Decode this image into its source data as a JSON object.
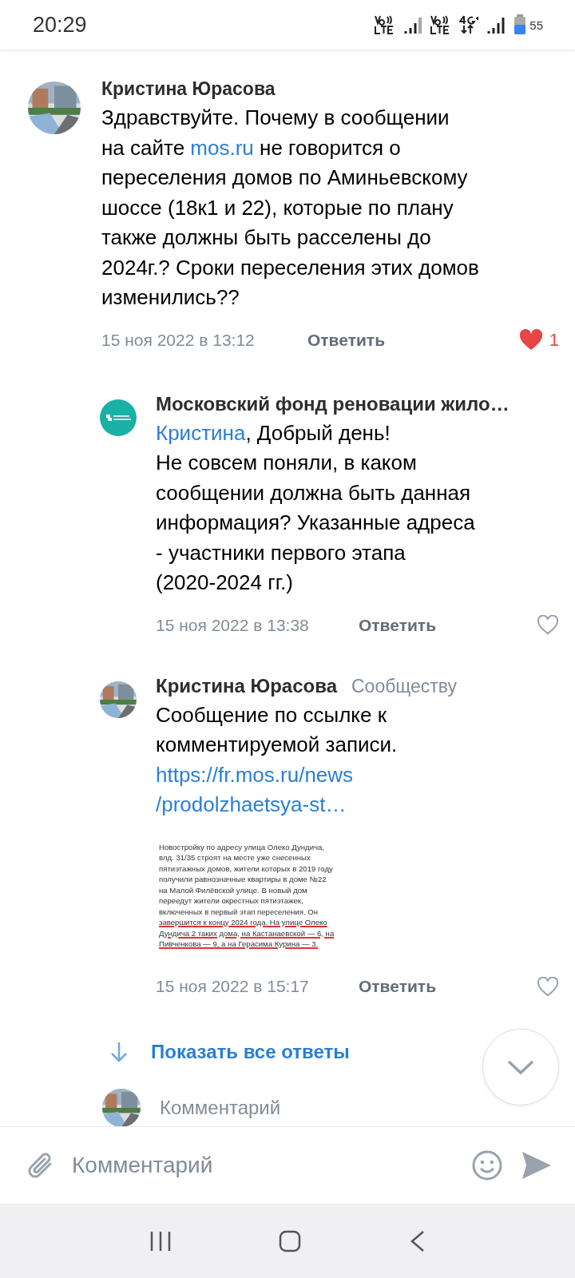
{
  "status_bar": {
    "time": "20:29",
    "battery": "55"
  },
  "comments": [
    {
      "kind": "comment",
      "author": "Кристина Юрасова",
      "avatar": {
        "kind": "picture"
      },
      "body": [
        {
          "kind": "text",
          "text": "Здравствуйте. Почему в сообщении\nна сайте "
        },
        {
          "kind": "link",
          "text": "mos.ru"
        },
        {
          "kind": "text",
          "text": " не говорится о\nпереселения домов по Аминьевскому\nшоссе (18к1 и 22), которые по плану\nтакже должны быть расселены до\n2024г.? Сроки переселения этих домов\nизменились??"
        }
      ],
      "date": "15 ноя 2022 в 13:12",
      "reply": "Ответить",
      "liked": true,
      "likes": "1"
    },
    {
      "kind": "reply",
      "author": "Московский фонд реновации жило…",
      "avatar": {
        "kind": "logo"
      },
      "body": [
        {
          "kind": "link",
          "text": "Кристина"
        },
        {
          "kind": "text",
          "text": ", Добрый день!\nНе совсем поняли, в каком\nсообщении должна быть данная\nинформация? Указанные адреса\n- участники первого этапа\n(2020-2024 гг.)"
        }
      ],
      "date": "15 ноя 2022 в 13:38",
      "reply": "Ответить",
      "liked": false
    },
    {
      "kind": "reply",
      "author": "Кристина Юрасова",
      "to": "Сообществу",
      "avatar": {
        "kind": "picture"
      },
      "body": [
        {
          "kind": "text",
          "text": "Сообщение по ссылке к\nкомментируемой записи."
        }
      ],
      "url": "https://fr.mos.ru/news\n/prodolzhaetsya-st…",
      "attachment": [
        {
          "text": "Новостройку по адресу улица Олеко Дундича,",
          "underlined": false
        },
        {
          "text": "влд. 31/35 строят на месте уже снесенных",
          "underlined": false
        },
        {
          "text": "пятиэтажных домов, жители которых в 2019 году",
          "underlined": false
        },
        {
          "text": "получили равнозначные квартиры в доме №22",
          "underlined": false
        },
        {
          "text": "на Малой Филёвской улице. В новый дом",
          "underlined": false
        },
        {
          "text": "переедут жители окрестных пятиэтажек,",
          "underlined": false
        },
        {
          "text": "включенных в первый этап переселения. Он",
          "underlined": false
        },
        {
          "text": "завершится к концу 2024 года. На улице Олеко",
          "underlined": true
        },
        {
          "text": "Дундича 2 таких дома, на Кастанаевской — 6, на",
          "underlined": true
        },
        {
          "text": "Пивченкова — 9, а на Герасима Курина — 3.",
          "underlined": true
        }
      ],
      "date": "15 ноя 2022 в 15:17",
      "reply": "Ответить",
      "liked": false
    }
  ],
  "show_all": "Показать все ответы",
  "comment_row": {
    "placeholder": "Комментарий"
  },
  "composer": {
    "placeholder": "Комментарий"
  }
}
